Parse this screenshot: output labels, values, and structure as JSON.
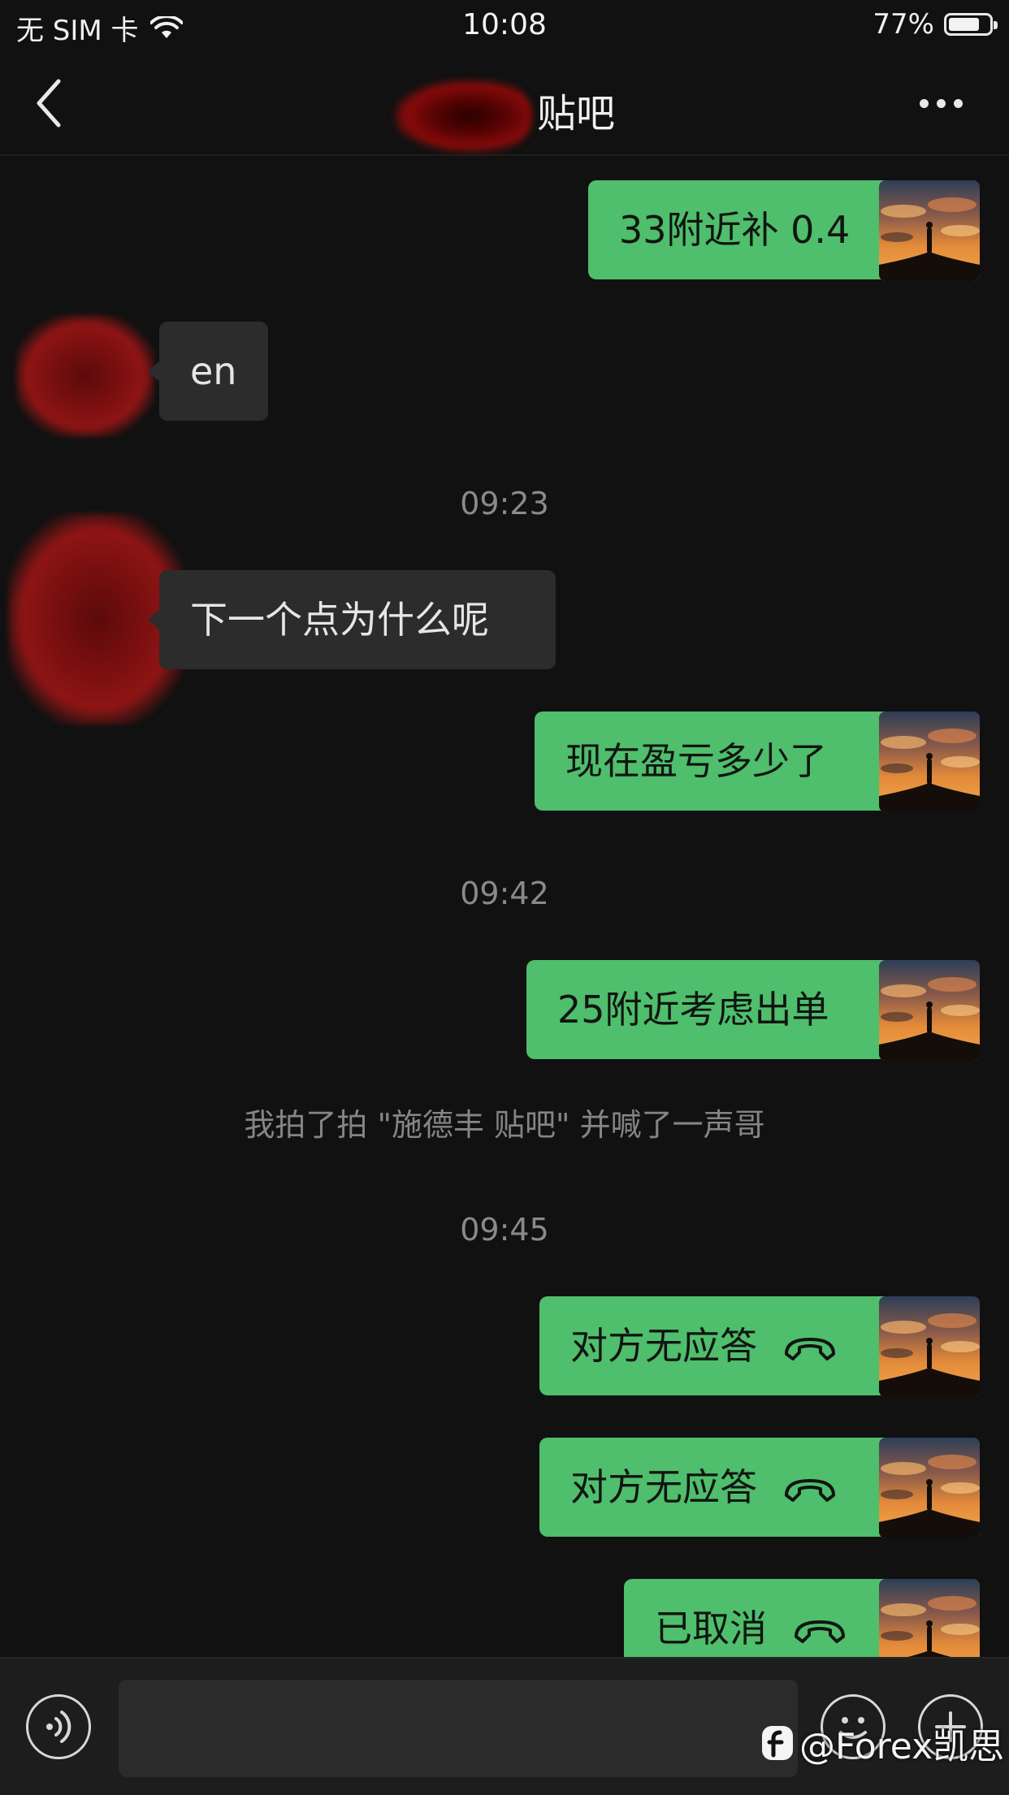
{
  "status_bar": {
    "carrier": "无 SIM 卡",
    "time": "10:08",
    "battery_percent": "77%",
    "battery_level": 0.77
  },
  "nav": {
    "title": "贴吧"
  },
  "messages": {
    "m1": "33附近补 0.4",
    "m2": "en",
    "ts1": "09:23",
    "m3": "下一个点为什么呢",
    "m4": "现在盈亏多少了",
    "ts2": "09:42",
    "m5": "25附近考虑出单",
    "sys1": "我拍了拍 \"施德丰 贴吧\" 并喊了一声哥",
    "ts3": "09:45",
    "m6": "对方无应答",
    "m7": "对方无应答",
    "m8": "已取消"
  },
  "watermark": {
    "text": "@Forex凯思"
  },
  "colors": {
    "bubble_me": "#4fbe6d",
    "bubble_other": "#2c2c2c",
    "background": "#111111"
  }
}
